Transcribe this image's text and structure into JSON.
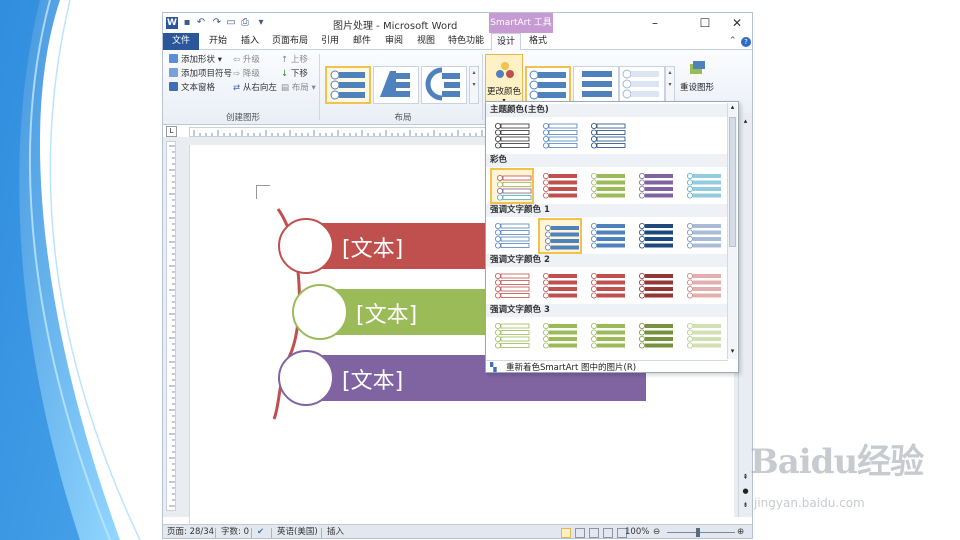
{
  "window": {
    "title": "图片处理 - Microsoft Word",
    "context_tab": "SmartArt 工具",
    "word_logo": "W",
    "quick_access": [
      "save-icon",
      "undo-icon",
      "redo-icon",
      "new-document-icon",
      "print-preview-icon",
      "customize-icon"
    ],
    "controls": [
      "minimize-icon",
      "maximize-icon",
      "close-icon"
    ]
  },
  "tabs": [
    "文件",
    "开始",
    "插入",
    "页面布局",
    "引用",
    "邮件",
    "审阅",
    "视图",
    "特色功能",
    "设计",
    "格式"
  ],
  "active_tab": "设计",
  "ribbon": {
    "create_graphic": {
      "label": "创建图形",
      "add_shape": "添加形状",
      "add_bullet": "添加项目符号",
      "text_pane": "文本窗格",
      "promote": "升级",
      "demote": "降级",
      "right_to_left": "从右向左",
      "move_up": "上移",
      "move_down": "下移",
      "layout": "布局"
    },
    "layouts": {
      "label": "布局"
    },
    "change_colors": "更改颜色",
    "reset_graphic": "重设图形"
  },
  "smartart": {
    "items": [
      {
        "text": "[文本]",
        "color": "#c0504d"
      },
      {
        "text": "[文本]",
        "color": "#9bbb59"
      },
      {
        "text": "[文本]",
        "color": "#8064a2"
      }
    ],
    "line_color": "#c0504d"
  },
  "gallery": {
    "sections": [
      {
        "title": "主题颜色(主色)",
        "items": [
          "#2f2f2f",
          "#4f81bd",
          "#1f497d"
        ]
      },
      {
        "title": "彩色",
        "items": [
          "colorful-1",
          "#c0504d",
          "#9bbb59",
          "#8064a2",
          "#4bacc6"
        ]
      },
      {
        "title": "强调文字颜色 1",
        "items": [
          "#4f81bd",
          "#4f81bd",
          "#4f81bd",
          "#1f497d",
          "#6f8fbd"
        ]
      },
      {
        "title": "强调文字颜色 2",
        "items": [
          "#c0504d",
          "#c0504d",
          "#c0504d",
          "#943634",
          "#d07a78"
        ]
      },
      {
        "title": "强调文字颜色 3",
        "items": [
          "#9bbb59",
          "#9bbb59",
          "#9bbb59",
          "#76923c",
          "#b4cd80"
        ]
      }
    ],
    "footer": "重新着色SmartArt 图中的图片(R)"
  },
  "status_bar": {
    "page": "页面: 28/34",
    "words": "字数: 0",
    "language": "英语(美国)",
    "mode": "插入",
    "zoom": "100%"
  },
  "watermark": {
    "brand": "Baidu经验",
    "url": "jingyan.baidu.com"
  },
  "colors": {
    "accent": "#2b579a",
    "context": "#c89ad4",
    "highlight": "#f2c14e"
  }
}
